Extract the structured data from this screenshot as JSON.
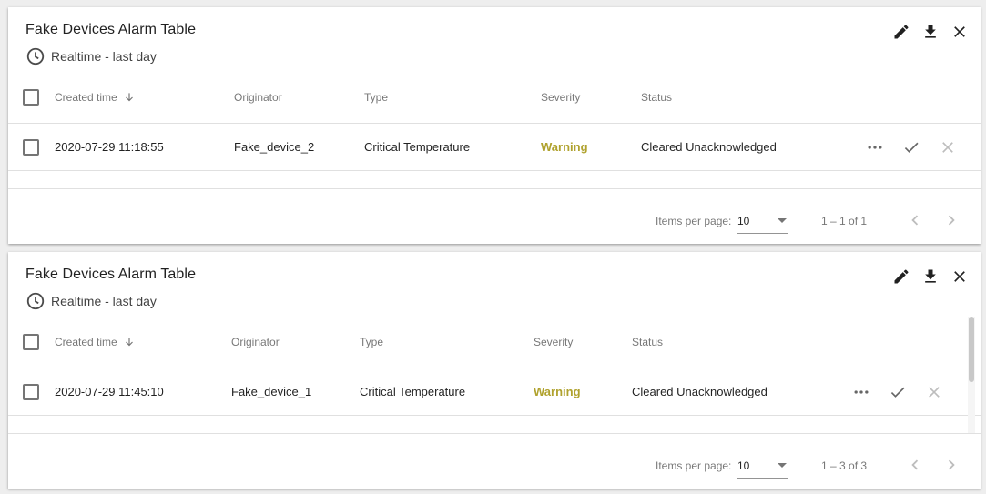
{
  "widgets": [
    {
      "title": "Fake Devices Alarm Table",
      "timewindow": "Realtime - last day",
      "columns": {
        "created_time": "Created time",
        "originator": "Originator",
        "type": "Type",
        "severity": "Severity",
        "status": "Status"
      },
      "rows": [
        {
          "created_time": "2020-07-29 11:18:55",
          "originator": "Fake_device_2",
          "type": "Critical Temperature",
          "severity": "Warning",
          "status": "Cleared Unacknowledged"
        }
      ],
      "paginator": {
        "items_per_page_label": "Items per page:",
        "items_per_page": "10",
        "range": "1 – 1 of 1"
      }
    },
    {
      "title": "Fake Devices Alarm Table",
      "timewindow": "Realtime - last day",
      "columns": {
        "created_time": "Created time",
        "originator": "Originator",
        "type": "Type",
        "severity": "Severity",
        "status": "Status"
      },
      "rows": [
        {
          "created_time": "2020-07-29 11:45:10",
          "originator": "Fake_device_1",
          "type": "Critical Temperature",
          "severity": "Warning",
          "status": "Cleared Unacknowledged"
        }
      ],
      "paginator": {
        "items_per_page_label": "Items per page:",
        "items_per_page": "10",
        "range": "1 – 3 of 3"
      }
    }
  ],
  "icons": {
    "edit": "pencil-icon",
    "download": "download-icon",
    "close": "close-icon",
    "clock": "clock-icon",
    "more": "more-horiz-icon",
    "acknowledge": "check-icon",
    "clear": "close-icon",
    "sort": "arrow-down-icon"
  },
  "colors": {
    "severity_warning": "#b0a22e"
  }
}
